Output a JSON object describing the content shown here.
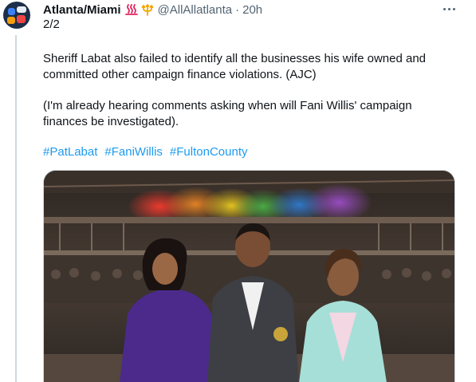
{
  "tweet": {
    "display_name": "Atlanta/Miami",
    "handle": "@AllAllatlanta",
    "separator": "·",
    "time": "20h",
    "thread_count": "2/2",
    "paragraphs": [
      "Sheriff Labat also failed to identify all the businesses his wife owned and committed other campaign finance violations. (AJC)",
      "(I'm already hearing comments asking when will Fani Willis' campaign finances be investigated)."
    ],
    "hashtags": [
      "#PatLabat",
      "#FaniWillis",
      "#FultonCounty"
    ],
    "badges": [
      "hot-springs-icon",
      "trident-icon"
    ],
    "more_menu": "more-options-icon"
  },
  "photo": {
    "description_icon": "photo-three-people-at-event",
    "accent_colors": [
      "#e63b2e",
      "#f08a24",
      "#f5d220",
      "#4cb648",
      "#2f7fd8",
      "#8a4fc8"
    ]
  }
}
